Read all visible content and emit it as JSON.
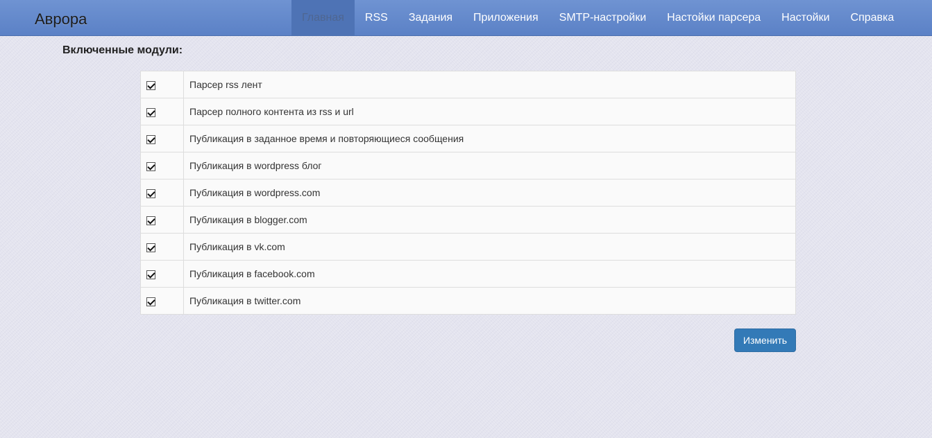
{
  "navbar": {
    "brand": "Аврора",
    "items": [
      {
        "label": "Главная",
        "active": true
      },
      {
        "label": "RSS"
      },
      {
        "label": "Задания"
      },
      {
        "label": "Приложения"
      },
      {
        "label": "SMTP-настройки"
      },
      {
        "label": "Настойки парсера"
      },
      {
        "label": "Настойки"
      },
      {
        "label": "Справка"
      }
    ]
  },
  "main": {
    "title": "Включенные модули:",
    "modules": [
      {
        "label": "Парсер rss лент",
        "checked": true
      },
      {
        "label": "Парсер полного контента из rss и url",
        "checked": true
      },
      {
        "label": "Публикация в заданное время и повторяющиеся сообщения",
        "checked": true
      },
      {
        "label": "Публикация в wordpress блог",
        "checked": true
      },
      {
        "label": "Публикация в wordpress.com",
        "checked": true
      },
      {
        "label": "Публикация в blogger.com",
        "checked": true
      },
      {
        "label": "Публикация в vk.com",
        "checked": true
      },
      {
        "label": "Публикация в facebook.com",
        "checked": true
      },
      {
        "label": "Публикация в twitter.com",
        "checked": true
      }
    ],
    "submit_label": "Изменить"
  },
  "colors": {
    "navbar": "#5b81c6",
    "navbar_active": "#4e73b5",
    "button": "#337ab7",
    "background": "#e4e4ef"
  }
}
